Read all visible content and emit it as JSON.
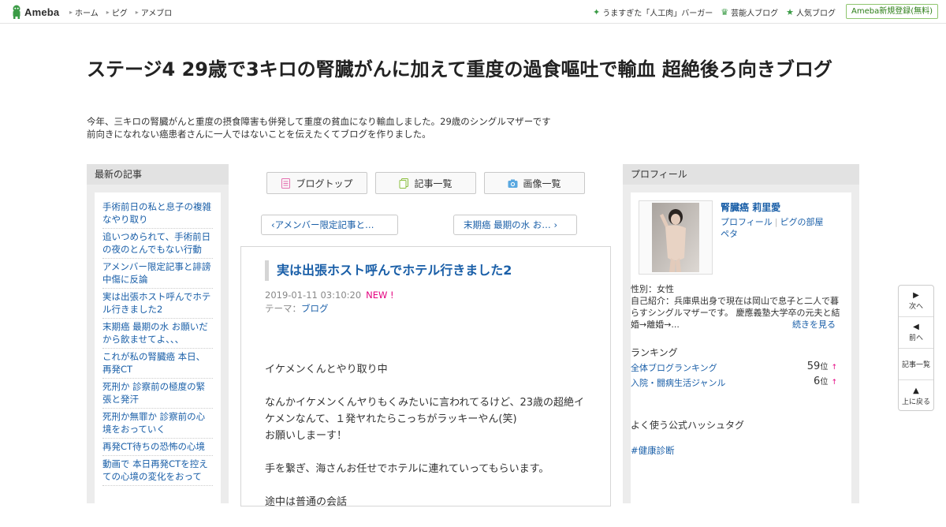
{
  "header": {
    "logo_text": "Ameba",
    "global_nav": [
      "ホーム",
      "ピグ",
      "アメブロ"
    ],
    "right_nav": [
      "うますぎた「人工肉」バーガー",
      "芸能人ブログ",
      "人気ブログ"
    ],
    "signup_label": "Ameba新規登録(無料)"
  },
  "blog": {
    "title": "ステージ4 29歳で3キロの腎臓がんに加えて重度の過食嘔吐で輸血 超絶後ろ向きブログ",
    "description_line1": "今年、三キロの腎臓がんと重度の摂食障害も併発して重度の貧血になり輸血しました。29歳のシングルマザーです",
    "description_line2": "前向きになれない癌患者さんに一人ではないことを伝えたくてブログを作りました。"
  },
  "recent": {
    "heading": "最新の記事",
    "items": [
      "手術前日の私と息子の複雑なやり取り",
      "追いつめられて、手術前日の夜のとんでもない行動",
      "アメンバー限定記事と誹謗中傷に反論",
      "実は出張ホスト呼んでホテル行きました2",
      "末期癌 最期の水 お願いだから飲ませてよ、、、",
      "これが私の腎臓癌 本日、再発CT",
      "死刑か 診察前の極度の緊張と発汗",
      "死刑か無罪か 診察前の心境をおっていく",
      "再発CT待ちの恐怖の心境",
      "動画で 本日再発CTを控えての心境の変化をおって"
    ]
  },
  "toolbar": {
    "blog_top": "ブログトップ",
    "article_list": "記事一覧",
    "image_list": "画像一覧",
    "prev_article": "アメンバー限定記事と…",
    "next_article": "末期癌 最期の水 お…"
  },
  "article": {
    "title": "実は出張ホスト呼んでホテル行きました2",
    "date": "2019-01-11 03:10:20",
    "new_label": "NEW !",
    "theme_prefix": "テーマ：",
    "theme": "ブログ",
    "paragraphs": [
      "イケメンくんとやり取り中",
      "なんかイケメンくんヤりもくみたいに言われてるけど、23歳の超絶イケメンなんて、１発ヤれたらこっちがラッキーやん(笑)\nお願いしまーす！",
      "手を繋ぎ、海さんお任せでホテルに連れていってもらいます。",
      "途中は普通の会話"
    ]
  },
  "profile": {
    "heading": "プロフィール",
    "name": "腎臓癌 莉里愛",
    "link_profile": "プロフィール",
    "link_pig": "ピグの部屋",
    "link_peta": "ペタ",
    "gender": "性別：女性",
    "intro": "自己紹介：兵庫県出身で現在は岡山で息子と二人で暮らすシングルマザーです。 慶應義塾大学卒の元夫と結婚→離婚→...",
    "more_label": "続きを見る",
    "ranking_heading": "ランキング",
    "rankings": [
      {
        "label": "全体ブログランキング",
        "value": "59",
        "unit": "位",
        "trend": "↑"
      },
      {
        "label": "入院・闘病生活ジャンル",
        "value": "6",
        "unit": "位",
        "trend": "↑"
      }
    ],
    "hashtag_heading": "よく使う公式ハッシュタグ",
    "hashtag": "#健康診断"
  },
  "side_nav": {
    "next": "次へ",
    "prev": "前へ",
    "list": "記事一覧",
    "top": "上に戻る"
  }
}
